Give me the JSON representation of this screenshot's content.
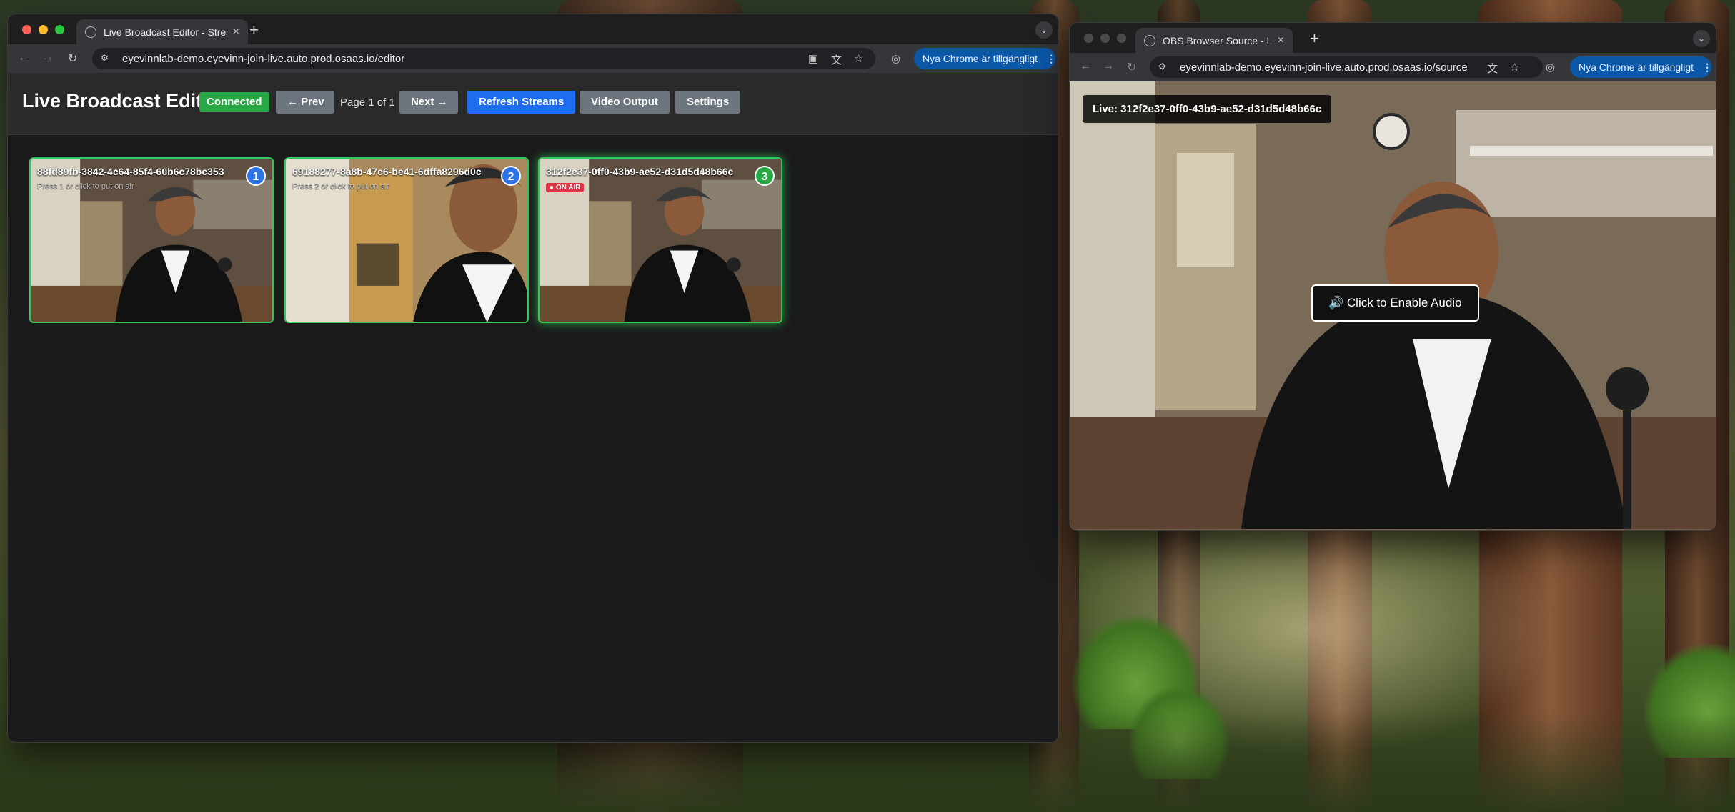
{
  "editor_window": {
    "tab_title": "Live Broadcast Editor - Strea",
    "url": "eyevinnlab-demo.eyevinn-join-live.auto.prod.osaas.io/editor",
    "update_badge": "Nya Chrome är tillgängligt"
  },
  "editor_page": {
    "title": "Live Broadcast Editor",
    "status": "Connected",
    "prev_label": "← Prev",
    "page_info": "Page 1 of 1",
    "next_label": "Next →",
    "refresh_label": "Refresh Streams",
    "video_output_label": "Video Output",
    "settings_label": "Settings",
    "streams": [
      {
        "id": "88fd89fb-3842-4c64-85f4-60b6c78bc353",
        "number": "1",
        "hint": "Press 1 or click to put on air",
        "on_air": false
      },
      {
        "id": "69188277-8a8b-47c6-be41-6dffa8296d0c",
        "number": "2",
        "hint": "Press 2 or click to put on air",
        "on_air": false
      },
      {
        "id": "312f2e37-0ff0-43b9-ae52-d31d5d48b66c",
        "number": "3",
        "badge": "● ON AIR",
        "on_air": true
      }
    ]
  },
  "obs_window": {
    "tab_title": "OBS Browser Source - Live St",
    "url": "eyevinnlab-demo.eyevinn-join-live.auto.prod.osaas.io/source",
    "update_badge": "Nya Chrome är tillgängligt"
  },
  "obs_page": {
    "live_label": "Live: 312f2e37-0ff0-43b9-ae52-d31d5d48b66c",
    "audio_button": "🔊 Click to Enable Audio"
  },
  "colors": {
    "connected": "#28a745",
    "on_air": "#dc3545",
    "refresh": "#1e6cf0",
    "card_border": "#34c759",
    "number_blue": "#2f74e6",
    "number_green": "#28a745"
  }
}
